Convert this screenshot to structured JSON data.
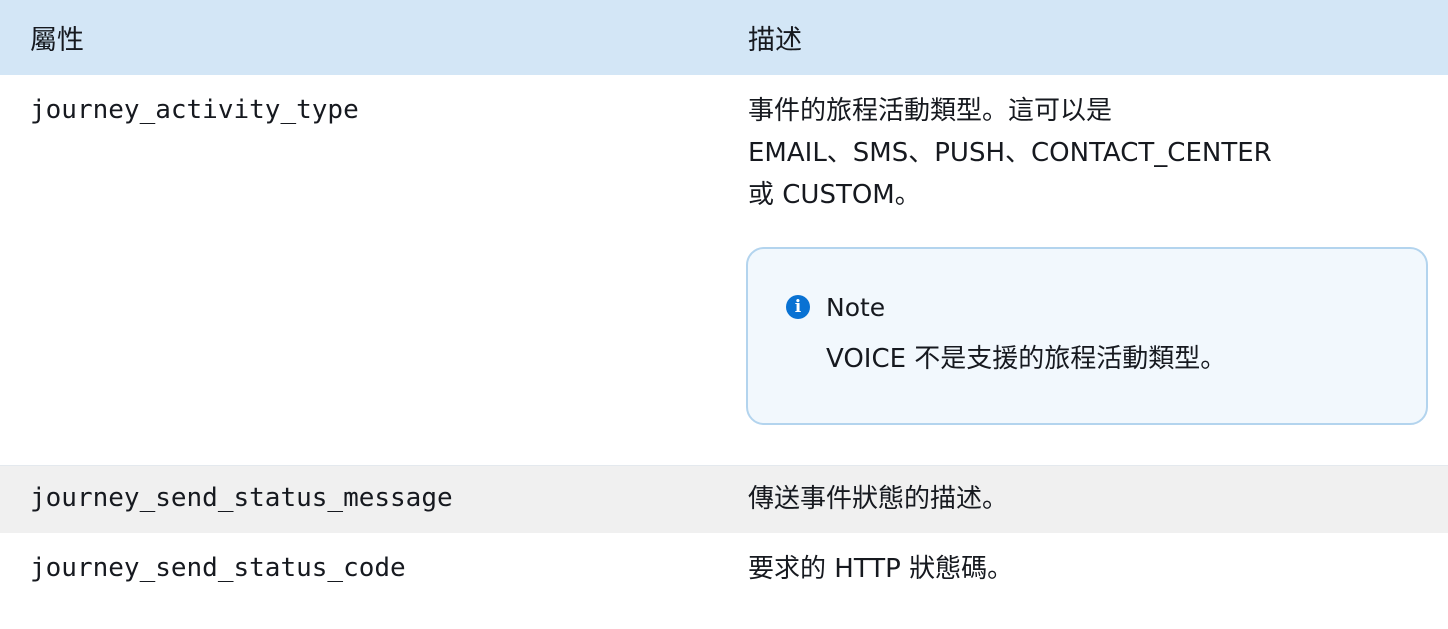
{
  "table": {
    "headers": {
      "attribute": "屬性",
      "description": "描述"
    },
    "rows": [
      {
        "attribute": "journey_activity_type",
        "description_lines": [
          "事件的旅程活動類型。這可以是",
          "EMAIL、SMS、PUSH、CONTACT_CENTER",
          "或 CUSTOM。"
        ],
        "note": {
          "icon": "info-icon",
          "title": "Note",
          "body": "VOICE 不是支援的旅程活動類型。"
        }
      },
      {
        "attribute": "journey_send_status_message",
        "description": "傳送事件狀態的描述。"
      },
      {
        "attribute": "journey_send_status_code",
        "description": "要求的 HTTP 狀態碼。"
      }
    ]
  },
  "colors": {
    "header_background": "#d3e6f6",
    "striped_row_background": "#f0f0f0",
    "note_border": "#b3d4ee",
    "note_background": "#f2f8fd",
    "info_icon": "#0972d3"
  }
}
